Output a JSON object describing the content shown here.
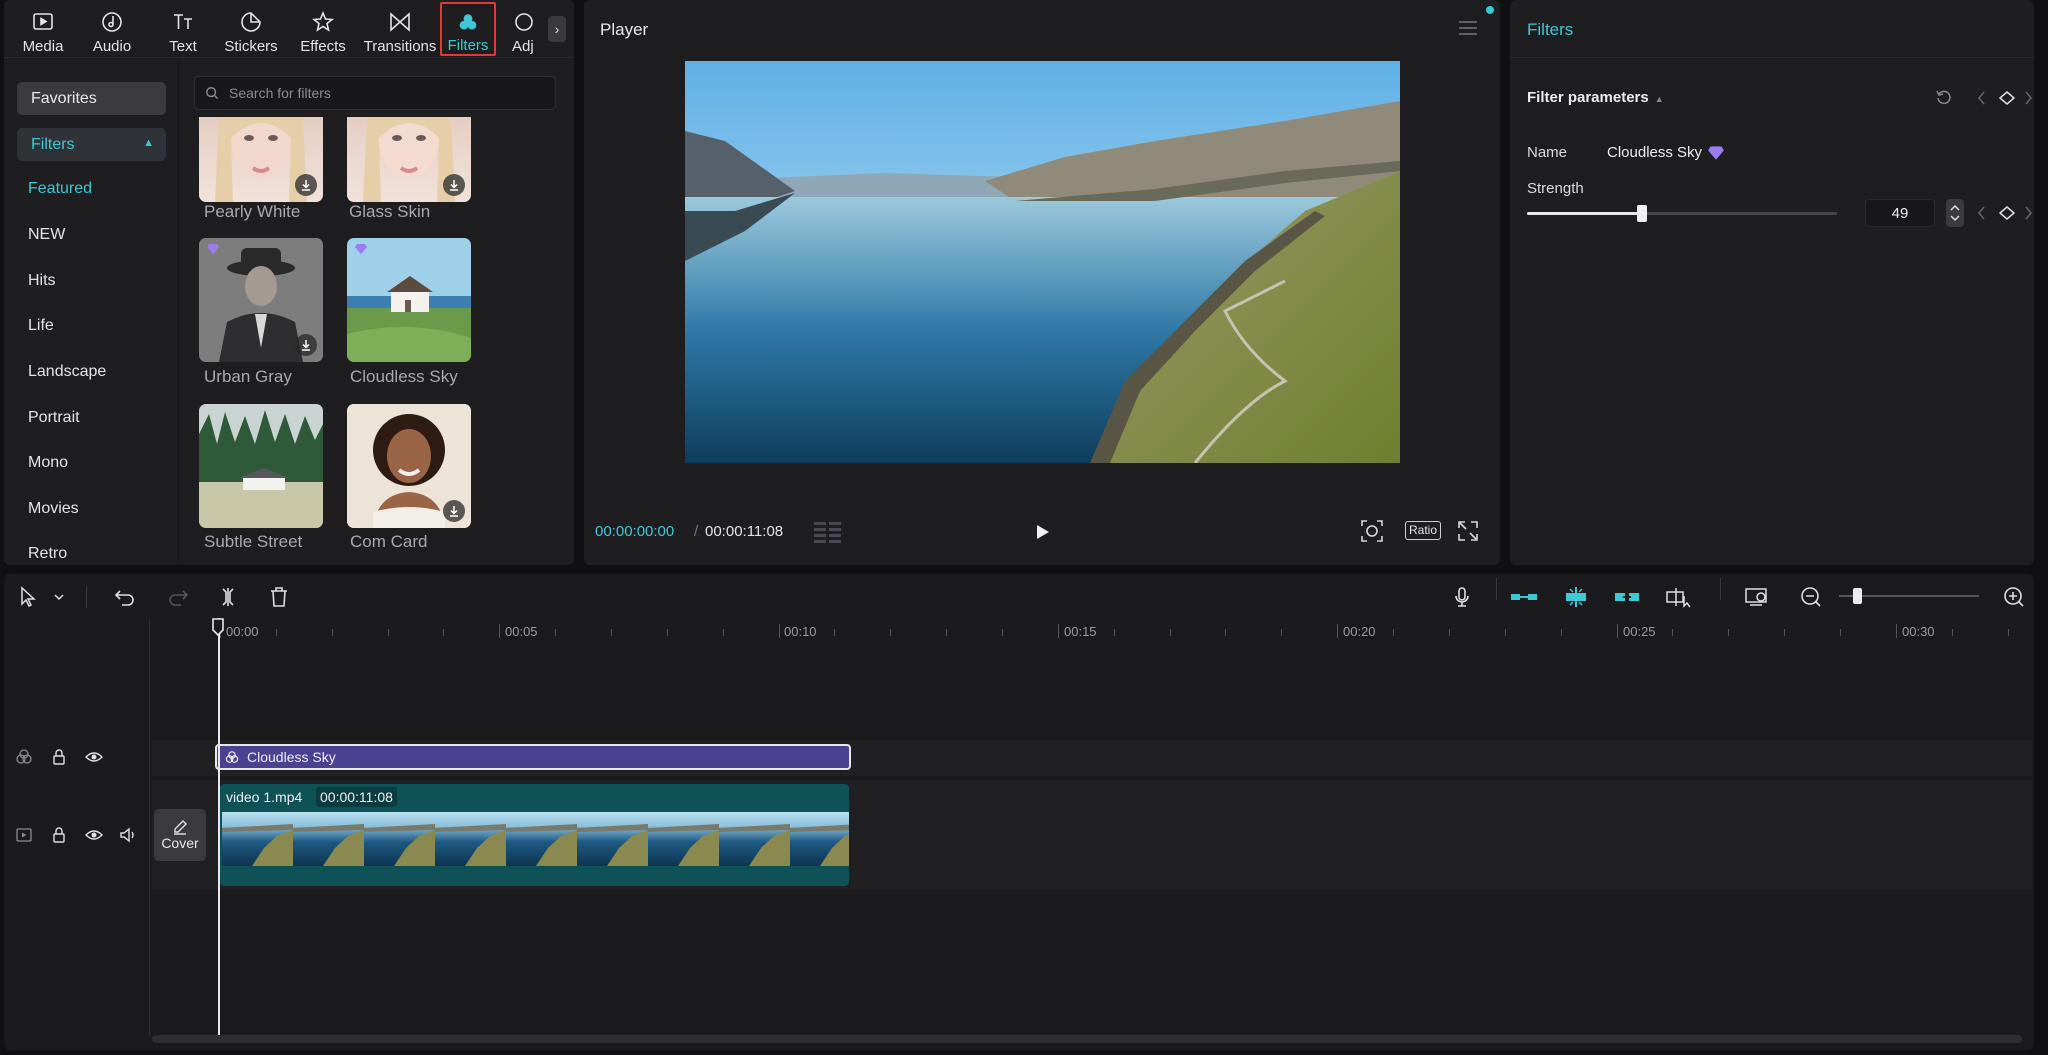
{
  "toolbar": {
    "tabs": [
      {
        "label": "Media",
        "icon": "media-icon"
      },
      {
        "label": "Audio",
        "icon": "audio-icon"
      },
      {
        "label": "Text",
        "icon": "text-icon"
      },
      {
        "label": "Stickers",
        "icon": "stickers-icon"
      },
      {
        "label": "Effects",
        "icon": "effects-icon"
      },
      {
        "label": "Transitions",
        "icon": "transitions-icon"
      },
      {
        "label": "Filters",
        "icon": "filters-icon",
        "active": true
      },
      {
        "label": "Adj",
        "icon": "adjustment-icon"
      }
    ]
  },
  "categories": {
    "favorites": "Favorites",
    "filters": "Filters",
    "items": [
      "Featured",
      "NEW",
      "Hits",
      "Life",
      "Landscape",
      "Portrait",
      "Mono",
      "Movies",
      "Retro"
    ]
  },
  "search": {
    "placeholder": "Search for filters"
  },
  "filter_grid": [
    {
      "label": "Pearly White",
      "download": true
    },
    {
      "label": "Glass Skin",
      "download": true
    },
    {
      "label": "Urban Gray",
      "download": true,
      "premium": true
    },
    {
      "label": "Cloudless Sky",
      "download": false,
      "premium": true
    },
    {
      "label": "Subtle Street",
      "download": false
    },
    {
      "label": "Com Card",
      "download": true
    }
  ],
  "player": {
    "title": "Player",
    "current_time": "00:00:00:00",
    "separator": "/",
    "total_time": "00:00:11:08",
    "ratio_label": "Ratio"
  },
  "filters_panel": {
    "title": "Filters",
    "section": "Filter parameters",
    "name_label": "Name",
    "name_value": "Cloudless Sky",
    "strength_label": "Strength",
    "strength_value": "49",
    "strength_fraction": 0.49
  },
  "timeline": {
    "ruler": [
      "00:00",
      "00:05",
      "00:10",
      "00:15",
      "00:20",
      "00:25",
      "00:30"
    ],
    "filter_clip_label": "Cloudless Sky",
    "video_clip_name": "video 1.mp4",
    "video_clip_duration": "00:00:11:08",
    "cover_label": "Cover"
  },
  "colors": {
    "accent": "#3dc8d6",
    "filter_clip": "#4a4190",
    "video_clip": "#0e5157",
    "highlight": "#e53935"
  }
}
